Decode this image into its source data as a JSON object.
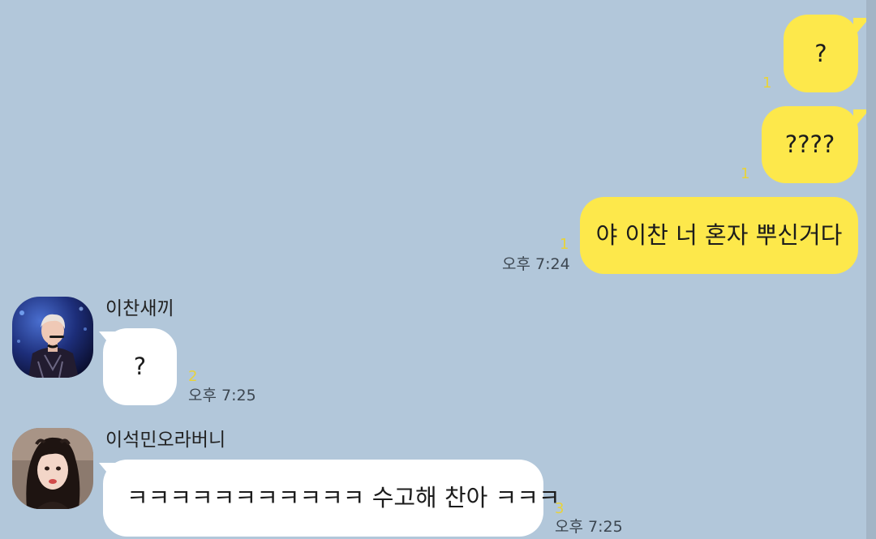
{
  "messages": [
    {
      "from": "me",
      "text": "?",
      "unread": "1"
    },
    {
      "from": "me",
      "text": "????",
      "unread": "1"
    },
    {
      "from": "me",
      "text": "야 이찬 너 혼자 뿌신거다",
      "unread": "1",
      "time": "오후 7:24"
    },
    {
      "from": "이찬새끼",
      "avatar": "avatar-stage-performer",
      "text": "?",
      "unread": "2",
      "time": "오후 7:25"
    },
    {
      "from": "이석민오라버니",
      "avatar": "avatar-woman-selfie",
      "text": "ㅋㅋㅋㅋㅋㅋㅋㅋㅋㅋㅋ 수고해 찬아 ㅋㅋㅋ",
      "unread": "3",
      "time": "오후 7:25"
    }
  ],
  "colors": {
    "background": "#b2c7da",
    "my_bubble": "#fde84b",
    "their_bubble": "#ffffff",
    "unread_count": "#e8d33a"
  }
}
